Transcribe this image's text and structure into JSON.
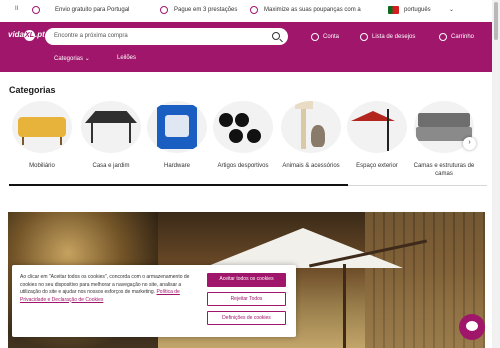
{
  "promo": {
    "pause": "II",
    "items": [
      {
        "text": "Envio gratuito para Portugal"
      },
      {
        "text": "Pague em 3 prestações"
      },
      {
        "text": "Maximize as suas poupanças com a"
      }
    ],
    "language": "português"
  },
  "header": {
    "logo_text": "vida",
    "logo_badge": "XL",
    "logo_suffix": ".pt",
    "search_placeholder": "Encontre a próxima compra",
    "account": "Conta",
    "wishlist": "Lista de desejos",
    "cart": "Carrinho"
  },
  "nav": {
    "categories": "Categorias",
    "auctions": "Leilões"
  },
  "categories": {
    "title": "Categorias",
    "items": [
      {
        "label": "Mobiliário"
      },
      {
        "label": "Casa e jardim"
      },
      {
        "label": "Hardware"
      },
      {
        "label": "Artigos desportivos"
      },
      {
        "label": "Animais & acessórios"
      },
      {
        "label": "Espaço exterior"
      },
      {
        "label": "Camas e estruturas de camas"
      }
    ],
    "scroll_progress": 0.71
  },
  "cookie": {
    "text": "Ao clicar em \"Aceitar todos os cookies\", concorda com o armazenamento de cookies no seu dispositivo para melhorar a navegação no site, analisar a utilização do site e ajudar nos nossos esforços de marketing. ",
    "link": "Política de Privacidade e Declaração de Cookies",
    "accept_all": "Aceitar todos os cookies",
    "reject_all": "Rejeitar Todos",
    "settings": "Definições de cookies"
  },
  "colors": {
    "brand": "#a0166b",
    "flag_green": "#0a6a1e",
    "flag_red": "#d21f1f"
  }
}
